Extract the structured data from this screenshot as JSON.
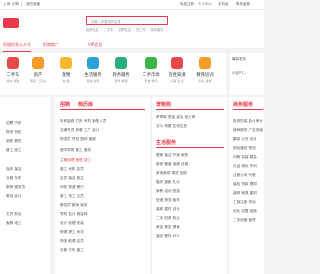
{
  "topbar": {
    "left": [
      "上海",
      "切换",
      "|",
      "我的收藏"
    ],
    "right": [
      "免费注册",
      "个人中心",
      "手机版",
      "联系客服"
    ]
  },
  "search": {
    "placeholder": "请输入你要找的信息"
  },
  "hot": [
    "租房信息",
    "二手车",
    "招聘信息",
    "找工作",
    "家政服务"
  ],
  "tabs": [
    "同城信息公众号",
    "招商推广",
    "VIP会员"
  ],
  "categories": [
    {
      "label": "二手车",
      "sub": "轿车 越野",
      "color": "#e84a4a"
    },
    {
      "label": "房产",
      "sub": "租房 二手房",
      "color": "#f39c2a"
    },
    {
      "label": "宠物",
      "sub": "狗 猫",
      "color": "#f5b82e"
    },
    {
      "label": "生活服务",
      "sub": "保洁 搬家",
      "color": "#2aa2d8"
    },
    {
      "label": "商务服务",
      "sub": "装修 翻译",
      "color": "#29b07a"
    },
    {
      "label": "二手市场",
      "sub": "家电 数码",
      "color": "#39b54a"
    },
    {
      "label": "百姓知道",
      "sub": "问答 生活",
      "color": "#e84a4a"
    },
    {
      "label": "教育培训",
      "sub": "职业 语言",
      "color": "#f39c2a"
    }
  ],
  "right_ad": {
    "title": "最新发布",
    "line": "小区PT..."
  },
  "left_panel": {
    "rows": [
      "招聘 汽车",
      "物流 司机",
      "销售 餐饮",
      "普工 技工",
      "保安 保洁",
      "仓管 叉车",
      "厨师 服务员",
      "美容 会计",
      "文员 前台",
      "客服 电工"
    ]
  },
  "jobs_panel": {
    "title": "招聘",
    "title2": "简历库",
    "rows": [
      "年底装修 打折 司机 销售人员",
      "交通专员 西餐 工厂 会计",
      "物流员 早班 厨师 客服",
      "超市导购 普工 服务",
      "主管经理 销售 技工",
      "普工 司机 店员",
      "店员 保洁 医生",
      "司机 快递 餐厅",
      "普工 电工 文员",
      "服务员 厨师 保安",
      "导购 会计 美容师",
      "设计 经理 安装",
      "修理 焊工 司机",
      "物流 助理 店员",
      "仓管 叉车 普工"
    ]
  },
  "estate_panel": {
    "title": "宠物狗",
    "rows": [
      "萨摩耶 泰迪 金毛 哈士奇",
      "法斗 柯基 拉布拉多"
    ],
    "title2": "生活服务",
    "rows2": [
      "搬家 保洁 开锁 家政",
      "维修 管道 保姆 月嫂",
      "家电维修 清洗 回收",
      "婚庆 摄影 礼仪",
      "家教 培训 旅游",
      "快递 物流 租车",
      "装修 建材 设计",
      "二手 回收 转让",
      "美容 美发 健身",
      "酒店 餐饮 KTV"
    ]
  },
  "biz_panel": {
    "title": "商务服务",
    "rows": [
      "投资担保 会计审计",
      "律师服务 广告传媒",
      "翻译 公关 设计",
      "网站建设 物流",
      "印刷 包装 展会",
      "礼品 商标 专利",
      "注册公司 代账",
      "保险 贷款 理财",
      "装修 家具 建材",
      "工商注册 年检",
      "创业 加盟 招商",
      "二手设备 租赁"
    ]
  }
}
